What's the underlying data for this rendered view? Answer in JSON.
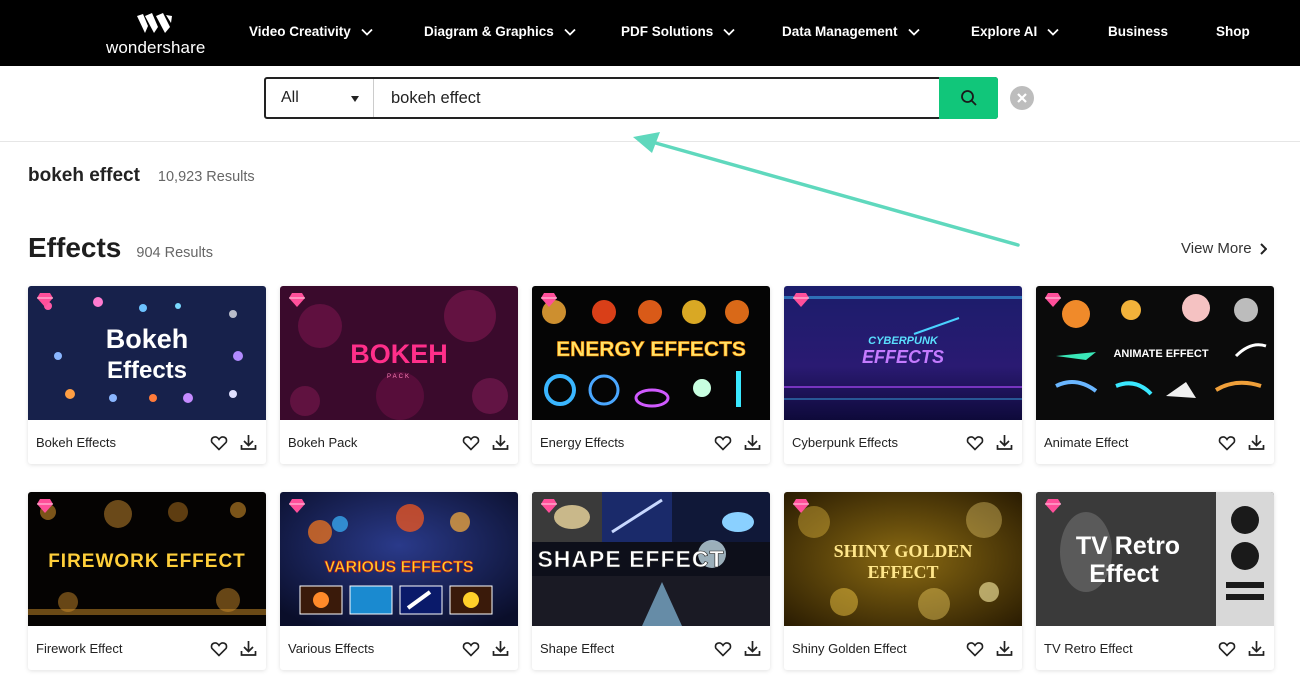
{
  "nav": {
    "logo_text": "wondershare",
    "items": [
      {
        "label": "Video Creativity",
        "has_menu": true
      },
      {
        "label": "Diagram & Graphics",
        "has_menu": true
      },
      {
        "label": "PDF Solutions",
        "has_menu": true
      },
      {
        "label": "Data Management",
        "has_menu": true
      },
      {
        "label": "Explore AI",
        "has_menu": true
      },
      {
        "label": "Business",
        "has_menu": false
      },
      {
        "label": "Shop",
        "has_menu": false
      }
    ]
  },
  "search": {
    "category": "All",
    "query": "bokeh effect"
  },
  "results": {
    "query": "bokeh effect",
    "count": "10,923 Results"
  },
  "section": {
    "title": "Effects",
    "count": "904 Results",
    "view_more": "View More"
  },
  "cards": [
    {
      "title": "Bokeh Effects",
      "thumb_text": "Bokeh Effects",
      "premium": true
    },
    {
      "title": "Bokeh Pack",
      "thumb_text": "BOKEH",
      "thumb_sub": "PACK",
      "premium": true
    },
    {
      "title": "Energy Effects",
      "thumb_text": "ENERGY EFFECTS",
      "premium": true
    },
    {
      "title": "Cyberpunk Effects",
      "thumb_text": "CYBERPUNK",
      "thumb_sub": "EFFECTS",
      "premium": true
    },
    {
      "title": "Animate Effect",
      "thumb_text": "ANIMATE EFFECT",
      "premium": true
    },
    {
      "title": "Firework Effect",
      "thumb_text": "FIREWORK EFFECT",
      "premium": true
    },
    {
      "title": "Various Effects",
      "thumb_text": "VARIOUS EFFECTS",
      "premium": true
    },
    {
      "title": "Shape Effect",
      "thumb_text": "SHAPE EFFECT",
      "premium": true
    },
    {
      "title": "Shiny Golden Effect",
      "thumb_text": "SHINY GOLDEN",
      "thumb_sub": "EFFECT",
      "premium": true
    },
    {
      "title": "TV Retro Effect",
      "thumb_text": "TV Retro",
      "thumb_sub": "Effect",
      "premium": true
    }
  ],
  "colors": {
    "nav_bg": "#000000",
    "search_button": "#11c67a",
    "annotation_arrow": "#5fd8bd",
    "premium_gem": "#ff4f9a"
  },
  "icons": {
    "search_button": "search-icon",
    "clear": "close-icon",
    "like": "heart-icon",
    "download": "download-icon",
    "premium": "gem-icon"
  }
}
